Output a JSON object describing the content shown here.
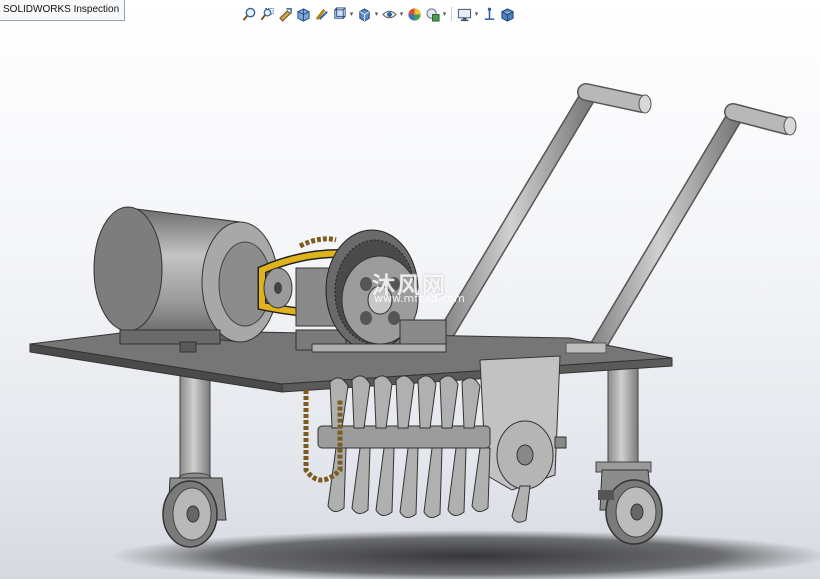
{
  "window": {
    "tab_title": "SOLIDWORKS Inspection"
  },
  "toolbar": {
    "items": [
      {
        "icon": "zoom-to-fit-icon"
      },
      {
        "icon": "zoom-to-area-icon"
      },
      {
        "icon": "previous-view-icon"
      },
      {
        "icon": "section-view-icon"
      },
      {
        "icon": "dynamic-annotation-views-icon"
      },
      {
        "icon": "view-orientation-icon"
      },
      {
        "icon": "display-style-icon"
      },
      {
        "icon": "hide-show-items-icon"
      },
      {
        "icon": "edit-appearance-icon"
      },
      {
        "icon": "apply-scene-icon"
      },
      {
        "icon": "view-settings-icon"
      },
      {
        "icon": "view-triad-icon"
      },
      {
        "icon": "3d-cube-icon"
      }
    ]
  },
  "watermark": {
    "text": "沐风网",
    "url": "www.mfcad.com"
  },
  "colors": {
    "metal": "#9a9a9a",
    "dark_metal": "#5a5a5a",
    "belt": "#e0b21c",
    "chain": "#8a6a2a"
  }
}
